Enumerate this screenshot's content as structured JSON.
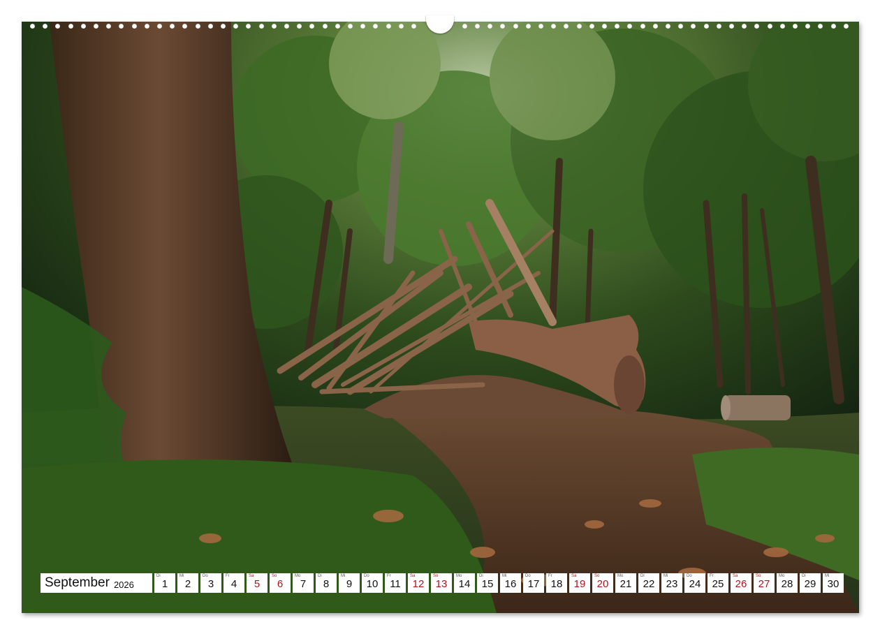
{
  "calendar": {
    "month": "September",
    "year": "2026",
    "days": [
      {
        "wd": "Di",
        "d": "1",
        "weekend": false
      },
      {
        "wd": "Mi",
        "d": "2",
        "weekend": false
      },
      {
        "wd": "Do",
        "d": "3",
        "weekend": false
      },
      {
        "wd": "Fr",
        "d": "4",
        "weekend": false
      },
      {
        "wd": "Sa",
        "d": "5",
        "weekend": true
      },
      {
        "wd": "So",
        "d": "6",
        "weekend": true
      },
      {
        "wd": "Mo",
        "d": "7",
        "weekend": false
      },
      {
        "wd": "Di",
        "d": "8",
        "weekend": false
      },
      {
        "wd": "Mi",
        "d": "9",
        "weekend": false
      },
      {
        "wd": "Do",
        "d": "10",
        "weekend": false
      },
      {
        "wd": "Fr",
        "d": "11",
        "weekend": false
      },
      {
        "wd": "Sa",
        "d": "12",
        "weekend": true
      },
      {
        "wd": "So",
        "d": "13",
        "weekend": true
      },
      {
        "wd": "Mo",
        "d": "14",
        "weekend": false
      },
      {
        "wd": "Di",
        "d": "15",
        "weekend": false
      },
      {
        "wd": "Mi",
        "d": "16",
        "weekend": false
      },
      {
        "wd": "Do",
        "d": "17",
        "weekend": false
      },
      {
        "wd": "Fr",
        "d": "18",
        "weekend": false
      },
      {
        "wd": "Sa",
        "d": "19",
        "weekend": true
      },
      {
        "wd": "So",
        "d": "20",
        "weekend": true
      },
      {
        "wd": "Mo",
        "d": "21",
        "weekend": false
      },
      {
        "wd": "Di",
        "d": "22",
        "weekend": false
      },
      {
        "wd": "Mi",
        "d": "23",
        "weekend": false
      },
      {
        "wd": "Do",
        "d": "24",
        "weekend": false
      },
      {
        "wd": "Fr",
        "d": "25",
        "weekend": false
      },
      {
        "wd": "Sa",
        "d": "26",
        "weekend": true
      },
      {
        "wd": "So",
        "d": "27",
        "weekend": true
      },
      {
        "wd": "Mo",
        "d": "28",
        "weekend": false
      },
      {
        "wd": "Di",
        "d": "29",
        "weekend": false
      },
      {
        "wd": "Mi",
        "d": "30",
        "weekend": false
      }
    ]
  },
  "colors": {
    "weekend": "#b3121b",
    "weekday": "#111111",
    "foliage": "#2f5a1c",
    "trunk": "#5a3a26",
    "path": "#5e3d2a"
  },
  "photo": {
    "subject": "forest-hut-of-branches"
  }
}
